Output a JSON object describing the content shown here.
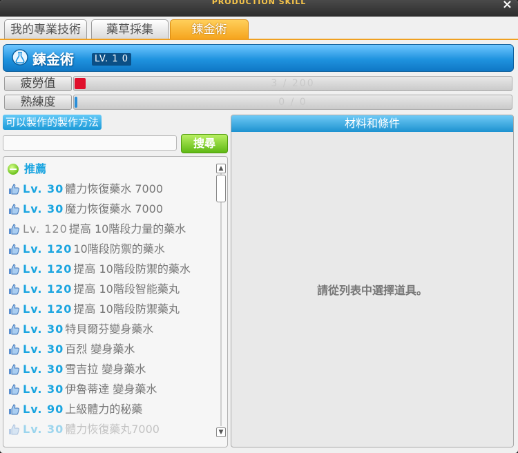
{
  "window": {
    "title": "PRODUCTION SKILL",
    "close_label": "×"
  },
  "tabs": [
    {
      "label": "我的專業技術"
    },
    {
      "label": "藥草採集"
    },
    {
      "label": "鍊金術"
    }
  ],
  "skill": {
    "name": "鍊金術",
    "level": "LV. 1 0"
  },
  "stats": {
    "fatigue": {
      "label": "疲勞值",
      "value": "3 / 200",
      "fraction": 0.015
    },
    "proficiency": {
      "label": "熟練度",
      "value": "0 / 0",
      "fraction": 0
    }
  },
  "recipes": {
    "header": "可以製作的製作方法",
    "search_placeholder": "",
    "search_button": "搜尋",
    "category": "推薦",
    "items": [
      {
        "level": "Lv. 30",
        "name": "體力恢復藥水 7000"
      },
      {
        "level": "Lv. 30",
        "name": "魔力恢復藥水 7000"
      },
      {
        "level": "Lv. 120",
        "name": "提高 10階段力量的藥水"
      },
      {
        "level": "Lv. 120",
        "name": "10階段防禦的藥水"
      },
      {
        "level": "Lv. 120",
        "name": "提高 10階段防禦的藥水"
      },
      {
        "level": "Lv. 120",
        "name": "提高 10階段智能藥丸"
      },
      {
        "level": "Lv. 120",
        "name": "提高 10階段防禦藥丸"
      },
      {
        "level": "Lv. 30",
        "name": "特貝爾芬變身藥水"
      },
      {
        "level": "Lv. 30",
        "name": "百烈 變身藥水"
      },
      {
        "level": "Lv. 30",
        "name": "雪吉拉 變身藥水"
      },
      {
        "level": "Lv. 30",
        "name": "伊魯蒂達 變身藥水"
      },
      {
        "level": "Lv. 90",
        "name": "上級體力的秘藥"
      },
      {
        "level": "Lv. 30",
        "name": "體力恢復藥丸7000"
      }
    ]
  },
  "materials": {
    "header": "材料和條件",
    "hint": "請從列表中選擇道具。"
  }
}
